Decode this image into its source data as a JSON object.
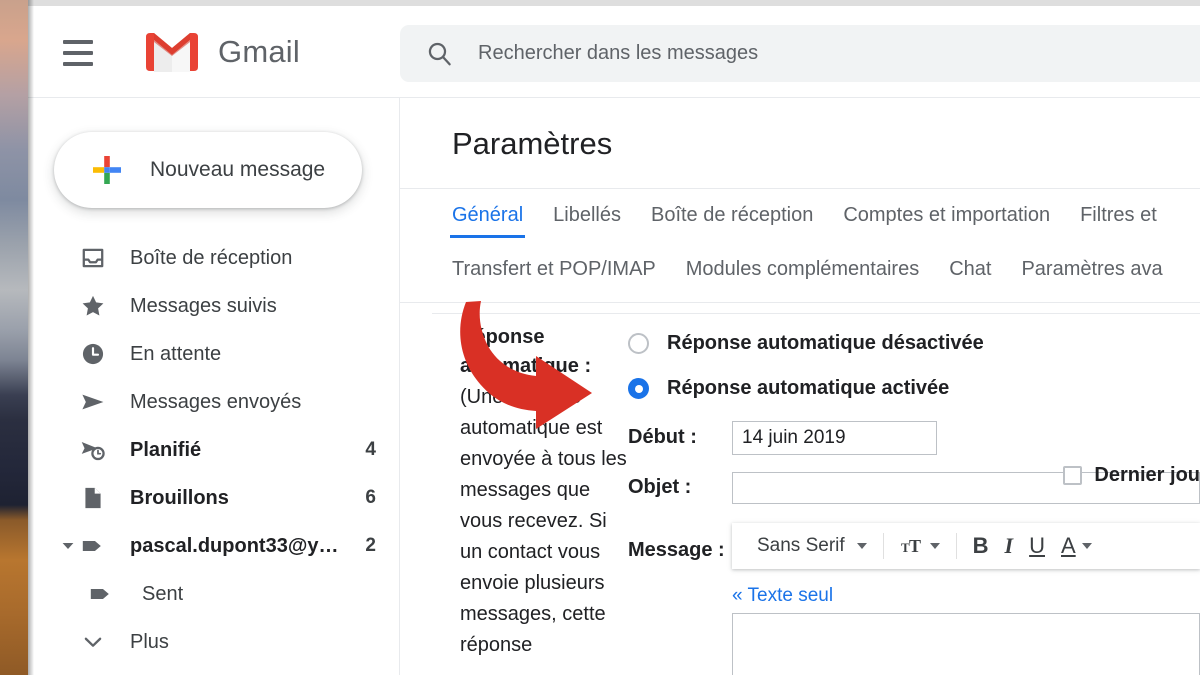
{
  "app": {
    "name": "Gmail",
    "menu_icon": "hamburger-menu-icon",
    "logo_icon": "gmail-logo-icon"
  },
  "search": {
    "icon": "search-icon",
    "placeholder": "Rechercher dans les messages",
    "value": ""
  },
  "sidebar": {
    "compose": {
      "label": "Nouveau message",
      "icon": "plus-icon"
    },
    "items": [
      {
        "label": "Boîte de réception",
        "icon": "inbox-icon",
        "count": "",
        "bold": false
      },
      {
        "label": "Messages suivis",
        "icon": "star-icon",
        "count": "",
        "bold": false
      },
      {
        "label": "En attente",
        "icon": "clock-icon",
        "count": "",
        "bold": false
      },
      {
        "label": "Messages envoyés",
        "icon": "send-icon",
        "count": "",
        "bold": false
      },
      {
        "label": "Planifié",
        "icon": "scheduled-icon",
        "count": "4",
        "bold": true
      },
      {
        "label": "Brouillons",
        "icon": "draft-icon",
        "count": "6",
        "bold": true
      },
      {
        "label": "pascal.dupont33@y…",
        "icon": "label-icon",
        "count": "2",
        "bold": true
      },
      {
        "label": "Sent",
        "icon": "label-icon",
        "count": "",
        "bold": false
      },
      {
        "label": "Plus",
        "icon": "chevron-down-icon",
        "count": "",
        "bold": false
      }
    ]
  },
  "settings": {
    "title": "Paramètres",
    "tabs_row1": [
      {
        "label": "Général",
        "active": true
      },
      {
        "label": "Libellés",
        "active": false
      },
      {
        "label": "Boîte de réception",
        "active": false
      },
      {
        "label": "Comptes et importation",
        "active": false
      },
      {
        "label": "Filtres et",
        "active": false
      }
    ],
    "tabs_row2": [
      {
        "label": "Transfert et POP/IMAP",
        "active": false
      },
      {
        "label": "Modules complémentaires",
        "active": false
      },
      {
        "label": "Chat",
        "active": false
      },
      {
        "label": "Paramètres ava",
        "active": false
      }
    ],
    "vacation": {
      "title": "Réponse automatique :",
      "description": "(Une réponse automatique est envoyée à tous les messages que vous recevez. Si un contact vous envoie plusieurs messages, cette réponse",
      "option_off": "Réponse automatique désactivée",
      "option_on": "Réponse automatique activée",
      "selected": "on",
      "start_label": "Début :",
      "start_value": "14 juin 2019",
      "lastday_label": "Dernier jou",
      "lastday_checked": false,
      "subject_label": "Objet :",
      "subject_value": "",
      "message_label": "Message :",
      "message_value": ""
    },
    "editor": {
      "font_name": "Sans Serif",
      "size_icon": "text-size-icon",
      "bold_icon": "bold-icon",
      "bold_glyph": "B",
      "italic_icon": "italic-icon",
      "italic_glyph": "I",
      "underline_icon": "underline-icon",
      "underline_glyph": "U",
      "color_icon": "text-color-icon",
      "color_glyph": "A",
      "plain_text_link": "« Texte seul"
    }
  },
  "annotation": {
    "arrow_icon": "red-arrow-annotation",
    "color": "#d93025",
    "points_to": "Réponse automatique activée"
  },
  "colors": {
    "accent_blue": "#1a73e8",
    "gmail_red": "#ea4335",
    "text_primary": "#202124",
    "text_secondary": "#5f6368",
    "border": "#e8eaed",
    "search_bg": "#f1f3f4"
  }
}
